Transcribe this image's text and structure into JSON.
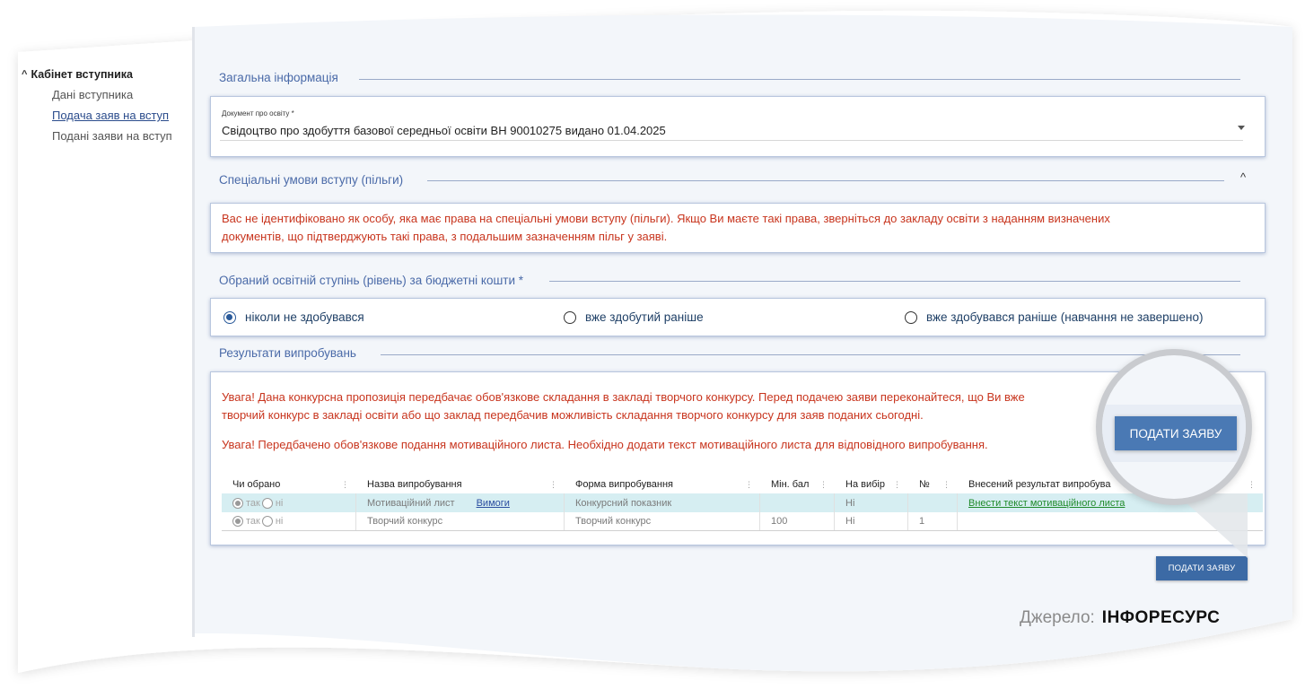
{
  "sidebar": {
    "heading": "Кабінет вступника",
    "items": [
      {
        "label": "Дані вступника",
        "active": false
      },
      {
        "label": "Подача заяв на вступ",
        "active": true
      },
      {
        "label": "Подані заяви на вступ",
        "active": false
      }
    ]
  },
  "general": {
    "title": "Загальна інформація",
    "doc_label": "Документ про освіту *",
    "doc_value": "Свідоцтво про здобуття базової середньої освіти ВН 90010275 видано 01.04.2025"
  },
  "special": {
    "title": "Спеціальні умови вступу (пільги)",
    "message_line1": "Вас не ідентифіковано як особу, яка має права на спеціальні умови вступу (пільги). Якщо Ви маєте такі права, зверніться до закладу освіти з наданням визначених",
    "message_line2": "документів, що підтверджують такі права, з подальшим зазначенням пільг у заяві."
  },
  "degree": {
    "title": "Обраний освітній ступінь (рівень) за бюджетні кошти *",
    "options": [
      {
        "label": "ніколи не здобувався",
        "checked": true
      },
      {
        "label": "вже здобутий раніше",
        "checked": false
      },
      {
        "label": "вже здобувався раніше (навчання не завершено)",
        "checked": false
      }
    ]
  },
  "results": {
    "title": "Результати випробувань",
    "warning1_line1": "Увага! Дана конкурсна пропозиція передбачає обов'язкове складання в закладі творчого конкурсу. Перед подачею заяви переконайтеся, що Ви вже",
    "warning1_line2": "творчий конкурс в закладі освіти або що заклад передбачив можливість складання творчого конкурсу для заяв поданих сьогодні.",
    "warning2": "Увага! Передбачено обов'язкове подання мотиваційного листа. Необхідно додати текст мотиваційного листа для відповідного випробування.",
    "columns": [
      "Чи обрано",
      "Назва випробування",
      "Форма випробування",
      "Мін. бал",
      "На вибір",
      "№",
      "Внесений результат випробува"
    ],
    "rows": [
      {
        "yes": "так",
        "no": "ні",
        "name": "Мотиваційний лист",
        "link": "Вимоги",
        "form": "Конкурсний показник",
        "min": "",
        "choice": "Ні",
        "num": "",
        "result_link": "Внести текст мотиваційного листа"
      },
      {
        "yes": "так",
        "no": "ні",
        "name": "Творчий конкурс",
        "link": "",
        "form": "Творчий конкурс",
        "min": "100",
        "choice": "Ні",
        "num": "1",
        "result_link": ""
      }
    ]
  },
  "submit_label": "ПОДАТИ ЗАЯВУ",
  "source": {
    "label": "Джерело:",
    "value": "ІНФОРЕСУРС"
  },
  "colors": {
    "accent": "#3c6aa5",
    "warning": "#c8351e",
    "link_green": "#1f8a2a",
    "highlight_row": "#d6eef2"
  }
}
